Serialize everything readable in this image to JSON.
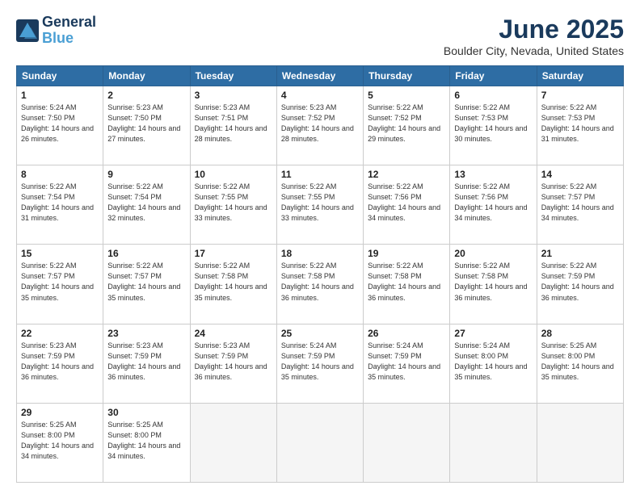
{
  "header": {
    "logo_line1": "General",
    "logo_line2": "Blue",
    "title": "June 2025",
    "subtitle": "Boulder City, Nevada, United States"
  },
  "days_of_week": [
    "Sunday",
    "Monday",
    "Tuesday",
    "Wednesday",
    "Thursday",
    "Friday",
    "Saturday"
  ],
  "weeks": [
    [
      {
        "day": "1",
        "sunrise": "Sunrise: 5:24 AM",
        "sunset": "Sunset: 7:50 PM",
        "daylight": "Daylight: 14 hours and 26 minutes."
      },
      {
        "day": "2",
        "sunrise": "Sunrise: 5:23 AM",
        "sunset": "Sunset: 7:50 PM",
        "daylight": "Daylight: 14 hours and 27 minutes."
      },
      {
        "day": "3",
        "sunrise": "Sunrise: 5:23 AM",
        "sunset": "Sunset: 7:51 PM",
        "daylight": "Daylight: 14 hours and 28 minutes."
      },
      {
        "day": "4",
        "sunrise": "Sunrise: 5:23 AM",
        "sunset": "Sunset: 7:52 PM",
        "daylight": "Daylight: 14 hours and 28 minutes."
      },
      {
        "day": "5",
        "sunrise": "Sunrise: 5:22 AM",
        "sunset": "Sunset: 7:52 PM",
        "daylight": "Daylight: 14 hours and 29 minutes."
      },
      {
        "day": "6",
        "sunrise": "Sunrise: 5:22 AM",
        "sunset": "Sunset: 7:53 PM",
        "daylight": "Daylight: 14 hours and 30 minutes."
      },
      {
        "day": "7",
        "sunrise": "Sunrise: 5:22 AM",
        "sunset": "Sunset: 7:53 PM",
        "daylight": "Daylight: 14 hours and 31 minutes."
      }
    ],
    [
      {
        "day": "8",
        "sunrise": "Sunrise: 5:22 AM",
        "sunset": "Sunset: 7:54 PM",
        "daylight": "Daylight: 14 hours and 31 minutes."
      },
      {
        "day": "9",
        "sunrise": "Sunrise: 5:22 AM",
        "sunset": "Sunset: 7:54 PM",
        "daylight": "Daylight: 14 hours and 32 minutes."
      },
      {
        "day": "10",
        "sunrise": "Sunrise: 5:22 AM",
        "sunset": "Sunset: 7:55 PM",
        "daylight": "Daylight: 14 hours and 33 minutes."
      },
      {
        "day": "11",
        "sunrise": "Sunrise: 5:22 AM",
        "sunset": "Sunset: 7:55 PM",
        "daylight": "Daylight: 14 hours and 33 minutes."
      },
      {
        "day": "12",
        "sunrise": "Sunrise: 5:22 AM",
        "sunset": "Sunset: 7:56 PM",
        "daylight": "Daylight: 14 hours and 34 minutes."
      },
      {
        "day": "13",
        "sunrise": "Sunrise: 5:22 AM",
        "sunset": "Sunset: 7:56 PM",
        "daylight": "Daylight: 14 hours and 34 minutes."
      },
      {
        "day": "14",
        "sunrise": "Sunrise: 5:22 AM",
        "sunset": "Sunset: 7:57 PM",
        "daylight": "Daylight: 14 hours and 34 minutes."
      }
    ],
    [
      {
        "day": "15",
        "sunrise": "Sunrise: 5:22 AM",
        "sunset": "Sunset: 7:57 PM",
        "daylight": "Daylight: 14 hours and 35 minutes."
      },
      {
        "day": "16",
        "sunrise": "Sunrise: 5:22 AM",
        "sunset": "Sunset: 7:57 PM",
        "daylight": "Daylight: 14 hours and 35 minutes."
      },
      {
        "day": "17",
        "sunrise": "Sunrise: 5:22 AM",
        "sunset": "Sunset: 7:58 PM",
        "daylight": "Daylight: 14 hours and 35 minutes."
      },
      {
        "day": "18",
        "sunrise": "Sunrise: 5:22 AM",
        "sunset": "Sunset: 7:58 PM",
        "daylight": "Daylight: 14 hours and 36 minutes."
      },
      {
        "day": "19",
        "sunrise": "Sunrise: 5:22 AM",
        "sunset": "Sunset: 7:58 PM",
        "daylight": "Daylight: 14 hours and 36 minutes."
      },
      {
        "day": "20",
        "sunrise": "Sunrise: 5:22 AM",
        "sunset": "Sunset: 7:58 PM",
        "daylight": "Daylight: 14 hours and 36 minutes."
      },
      {
        "day": "21",
        "sunrise": "Sunrise: 5:22 AM",
        "sunset": "Sunset: 7:59 PM",
        "daylight": "Daylight: 14 hours and 36 minutes."
      }
    ],
    [
      {
        "day": "22",
        "sunrise": "Sunrise: 5:23 AM",
        "sunset": "Sunset: 7:59 PM",
        "daylight": "Daylight: 14 hours and 36 minutes."
      },
      {
        "day": "23",
        "sunrise": "Sunrise: 5:23 AM",
        "sunset": "Sunset: 7:59 PM",
        "daylight": "Daylight: 14 hours and 36 minutes."
      },
      {
        "day": "24",
        "sunrise": "Sunrise: 5:23 AM",
        "sunset": "Sunset: 7:59 PM",
        "daylight": "Daylight: 14 hours and 36 minutes."
      },
      {
        "day": "25",
        "sunrise": "Sunrise: 5:24 AM",
        "sunset": "Sunset: 7:59 PM",
        "daylight": "Daylight: 14 hours and 35 minutes."
      },
      {
        "day": "26",
        "sunrise": "Sunrise: 5:24 AM",
        "sunset": "Sunset: 7:59 PM",
        "daylight": "Daylight: 14 hours and 35 minutes."
      },
      {
        "day": "27",
        "sunrise": "Sunrise: 5:24 AM",
        "sunset": "Sunset: 8:00 PM",
        "daylight": "Daylight: 14 hours and 35 minutes."
      },
      {
        "day": "28",
        "sunrise": "Sunrise: 5:25 AM",
        "sunset": "Sunset: 8:00 PM",
        "daylight": "Daylight: 14 hours and 35 minutes."
      }
    ],
    [
      {
        "day": "29",
        "sunrise": "Sunrise: 5:25 AM",
        "sunset": "Sunset: 8:00 PM",
        "daylight": "Daylight: 14 hours and 34 minutes."
      },
      {
        "day": "30",
        "sunrise": "Sunrise: 5:25 AM",
        "sunset": "Sunset: 8:00 PM",
        "daylight": "Daylight: 14 hours and 34 minutes."
      },
      null,
      null,
      null,
      null,
      null
    ]
  ]
}
